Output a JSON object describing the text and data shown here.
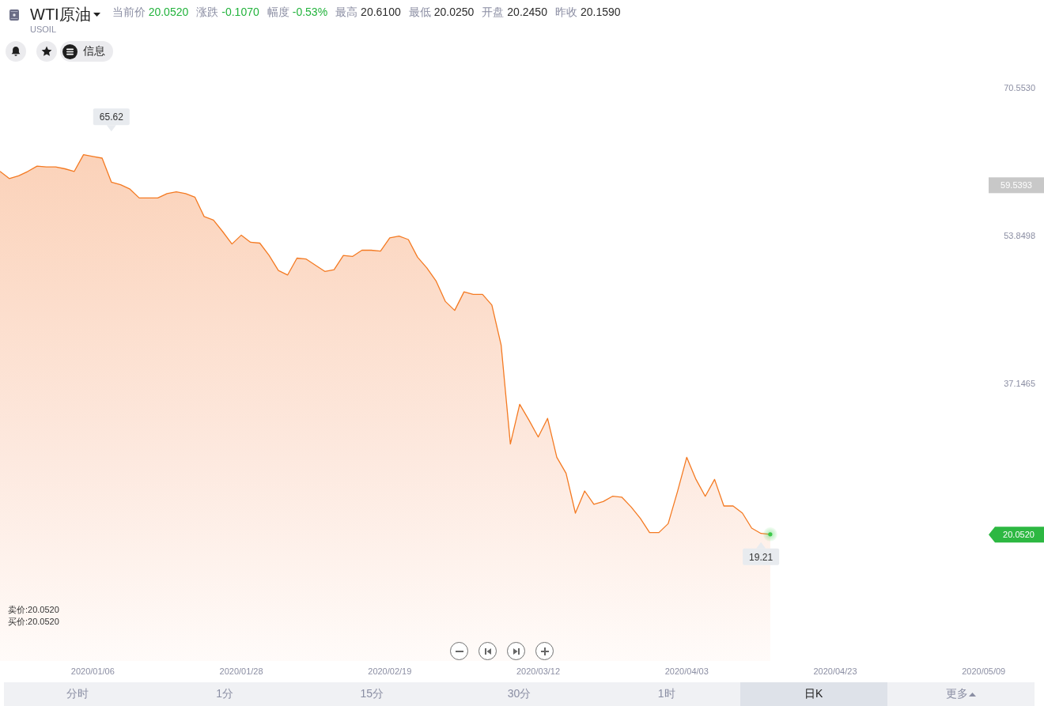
{
  "header": {
    "title": "WTI原油",
    "symbol": "USOIL",
    "stats": [
      {
        "label": "当前价",
        "value": "20.0520",
        "color": "#22b33c"
      },
      {
        "label": "涨跌",
        "value": "-0.1070",
        "color": "#22b33c"
      },
      {
        "label": "幅度",
        "value": "-0.53%",
        "color": "#22b33c"
      },
      {
        "label": "最高",
        "value": "20.6100",
        "color": "#2b2b2b"
      },
      {
        "label": "最低",
        "value": "20.0250",
        "color": "#2b2b2b"
      },
      {
        "label": "开盘",
        "value": "20.2450",
        "color": "#2b2b2b"
      },
      {
        "label": "昨收",
        "value": "20.1590",
        "color": "#2b2b2b"
      }
    ]
  },
  "toolbar": {
    "info_button": "信息"
  },
  "chart": {
    "chart_data": {
      "type": "area",
      "categories": [
        null,
        null,
        null,
        null,
        null,
        null,
        null,
        null,
        null,
        null,
        "2020/01/06",
        null,
        null,
        null,
        null,
        null,
        null,
        null,
        null,
        null,
        null,
        null,
        null,
        null,
        null,
        null,
        "2020/01/28",
        null,
        null,
        null,
        null,
        null,
        null,
        null,
        null,
        null,
        null,
        null,
        null,
        null,
        null,
        null,
        "2020/02/19",
        null,
        null,
        null,
        null,
        null,
        null,
        null,
        null,
        null,
        null,
        null,
        null,
        null,
        null,
        null,
        "2020/03/12",
        null,
        null,
        null,
        null,
        null,
        null,
        null,
        null,
        null,
        null,
        null,
        null,
        null,
        null,
        null,
        "2020/04/03",
        null,
        null,
        null,
        null,
        null,
        null,
        null,
        null,
        null,
        null,
        null,
        null,
        null,
        null,
        null,
        "2020/04/23",
        null,
        null,
        null,
        null,
        null,
        null,
        null,
        null,
        null,
        null,
        null,
        null,
        null,
        null,
        null,
        "2020/05/09",
        null,
        null,
        null,
        null,
        null,
        null
      ],
      "values": [
        61.1,
        60.3,
        60.6,
        61.1,
        61.7,
        61.6,
        61.6,
        61.4,
        61.1,
        63.0,
        62.8,
        62.6,
        59.9,
        59.6,
        59.1,
        58.1,
        58.1,
        58.1,
        58.6,
        58.8,
        58.6,
        58.2,
        56.0,
        55.6,
        54.3,
        52.9,
        53.9,
        53.1,
        53.0,
        51.6,
        49.9,
        49.4,
        51.3,
        51.2,
        50.5,
        49.8,
        50.0,
        51.6,
        51.5,
        52.2,
        52.2,
        52.1,
        53.6,
        53.8,
        53.4,
        51.4,
        50.2,
        48.7,
        46.4,
        45.4,
        47.5,
        47.2,
        47.2,
        46.0,
        41.5,
        30.3,
        34.8,
        33.0,
        31.1,
        33.2,
        28.8,
        27.0,
        22.5,
        25.0,
        23.5,
        23.8,
        24.4,
        24.3,
        23.2,
        21.9,
        20.3,
        20.3,
        21.3,
        24.9,
        28.8,
        26.3,
        24.4,
        26.3,
        23.3,
        23.3,
        22.5,
        20.8,
        20.2,
        20.1,
        null,
        null,
        null,
        null,
        null,
        null,
        null,
        null,
        null,
        null,
        null,
        null,
        null,
        null,
        null,
        null,
        null,
        null,
        null,
        null,
        null,
        null,
        null,
        null,
        null,
        null,
        null,
        null,
        null
      ],
      "ylim": [
        0.7,
        80.47
      ],
      "yticks": [
        {
          "value": 70.553,
          "label": "70.5530"
        },
        {
          "value": 53.8498,
          "label": "53.8498"
        },
        {
          "value": 37.1465,
          "label": "37.1465"
        }
      ],
      "annotations": [
        "65.62",
        "19.21"
      ]
    },
    "crosshair_price_label": "59.5393",
    "last_price_tag": "20.0520",
    "quotes": [
      "卖价:20.0520",
      "买价:20.0520"
    ]
  },
  "periods": [
    {
      "label": "分时",
      "kind": "period",
      "selected": false
    },
    {
      "label": "1分",
      "kind": "period",
      "selected": false
    },
    {
      "label": "15分",
      "kind": "period",
      "selected": false
    },
    {
      "label": "30分",
      "kind": "period",
      "selected": false
    },
    {
      "label": "1时",
      "kind": "period",
      "selected": false
    },
    {
      "label": "日K",
      "kind": "period",
      "selected": true
    },
    {
      "label": "更多",
      "kind": "menu",
      "selected": false
    }
  ]
}
